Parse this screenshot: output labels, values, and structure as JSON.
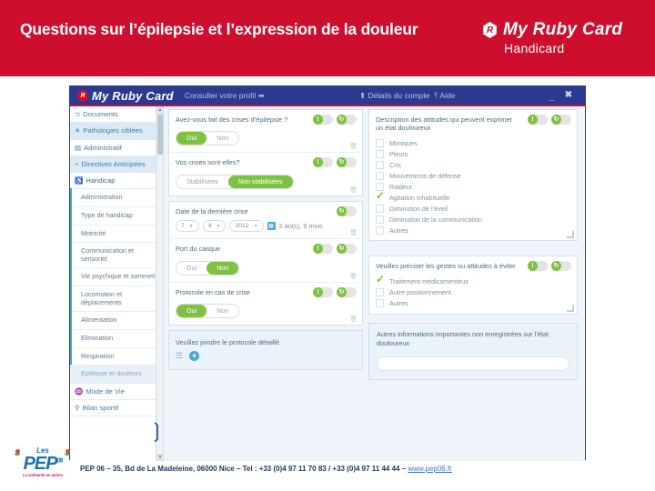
{
  "banner": {
    "title": "Questions sur l’épilepsie et l’expression de la douleur",
    "brand_mark": "R",
    "brand_name": "My Ruby Card",
    "brand_sub": "Handicard",
    "color": "#CE0E2D"
  },
  "app": {
    "titlebar": {
      "logo_mark": "R",
      "logo_text": "My Ruby Card",
      "profile_link": "Consulter votre profil ➡",
      "account_link": "⬆ Détails du compte",
      "help_link": "⸮ Aide",
      "minimize": "_",
      "close": "✖"
    },
    "sidebar": {
      "top_items": [
        {
          "icon": "⊃",
          "label": "Documents"
        },
        {
          "icon": "✳",
          "label": "Pathologies ciblées"
        },
        {
          "icon": "▤",
          "label": "Administratif"
        },
        {
          "icon": "⌁",
          "label": "Directives Anticipées"
        },
        {
          "icon": "♿",
          "label": "Handicap",
          "caret": "▼"
        }
      ],
      "sub_items": [
        "Administration",
        "Type de handicap",
        "Motricité",
        "Communication et sensoriel",
        "Vie psychique et sommeil",
        "Locomotion et déplacements",
        "Alimentation",
        "Elimination",
        "Respiration",
        "Epilepsie et douleurs"
      ],
      "selected_sub": "Epilepsie et douleurs",
      "bottom_items": [
        {
          "icon": "♒",
          "label": "Mode de Vie"
        },
        {
          "icon": "⚲",
          "label": "Bilan sportif"
        }
      ],
      "scroll_up": "▲",
      "scroll_down": "▼",
      "collapse_handle": "❳"
    },
    "middle_column": {
      "questions": [
        {
          "label": "Avez-vous fait des crises d’épilepsie ?",
          "options": [
            "Oui",
            "Non"
          ],
          "selected": "Oui",
          "alert_icon": "!",
          "history_icon": "↻"
        },
        {
          "label": "Vos crises sont-elles?",
          "options": [
            "Stabilisées",
            "Non stabilisées"
          ],
          "selected": "Non stabilisées",
          "alert_icon": "!",
          "history_icon": "↻"
        }
      ],
      "date_question": {
        "label": "Date de la dernière crise",
        "day": "7",
        "month": "4",
        "year": "2012",
        "caret": "▼",
        "calendar_icon": "▦",
        "elapsed": "2 an(s), 9 mois",
        "history_icon": "↻"
      },
      "questions2": [
        {
          "label": "Port du casque",
          "options": [
            "Oui",
            "Non"
          ],
          "selected": "Non",
          "alert_icon": "!",
          "history_icon": "↻"
        },
        {
          "label": "Protocole en cas de crise",
          "options": [
            "Oui",
            "Non"
          ],
          "selected": "Oui",
          "alert_icon": "!",
          "history_icon": "↻"
        }
      ],
      "attachment": {
        "label": "Veuillez joindre le protocole détaillé",
        "list_icon": "☰",
        "add_icon": "+"
      },
      "delete_icon": "🗑"
    },
    "right_column": {
      "attitudes_panel": {
        "title": "Description des attitudes qui peuvent exprimer un état douloureux",
        "alert_icon": "!",
        "history_icon": "↻",
        "items": [
          {
            "label": "Mimiques",
            "checked": false
          },
          {
            "label": "Pleurs",
            "checked": false
          },
          {
            "label": "Cris",
            "checked": false
          },
          {
            "label": "Mouvements de défense",
            "checked": false
          },
          {
            "label": "Raideur",
            "checked": false
          },
          {
            "label": "Agitation inhabituelle",
            "checked": true
          },
          {
            "label": "Diminution de l’éveil",
            "checked": false
          },
          {
            "label": "Diminution de la communication",
            "checked": false
          },
          {
            "label": "Autres",
            "checked": false
          }
        ]
      },
      "avoid_panel": {
        "title": "Veuillez préciser les gestes ou attitudes à éviter",
        "alert_icon": "!",
        "history_icon": "↻",
        "items": [
          {
            "label": "Traitement médicamenteux",
            "checked": true
          },
          {
            "label": "Autre positionnement",
            "checked": false
          },
          {
            "label": "Autres",
            "checked": false
          }
        ]
      },
      "info_panel": {
        "title": "Autres informations importantes non enregistrées sur l’état douloureux",
        "value": "",
        "placeholder": ""
      }
    }
  },
  "footer": {
    "text": "PEP 06 – 35, Bd de La Madeleine, 06000 Nice – Tel : +33 (0)4 97 11 70 83 / +33 (0)4 97 11 44 44 – ",
    "url": "www.pep06.fr",
    "logo": {
      "les": "Les",
      "main": "PEP",
      "num": "06",
      "tagline": "La solidarité en action"
    }
  }
}
